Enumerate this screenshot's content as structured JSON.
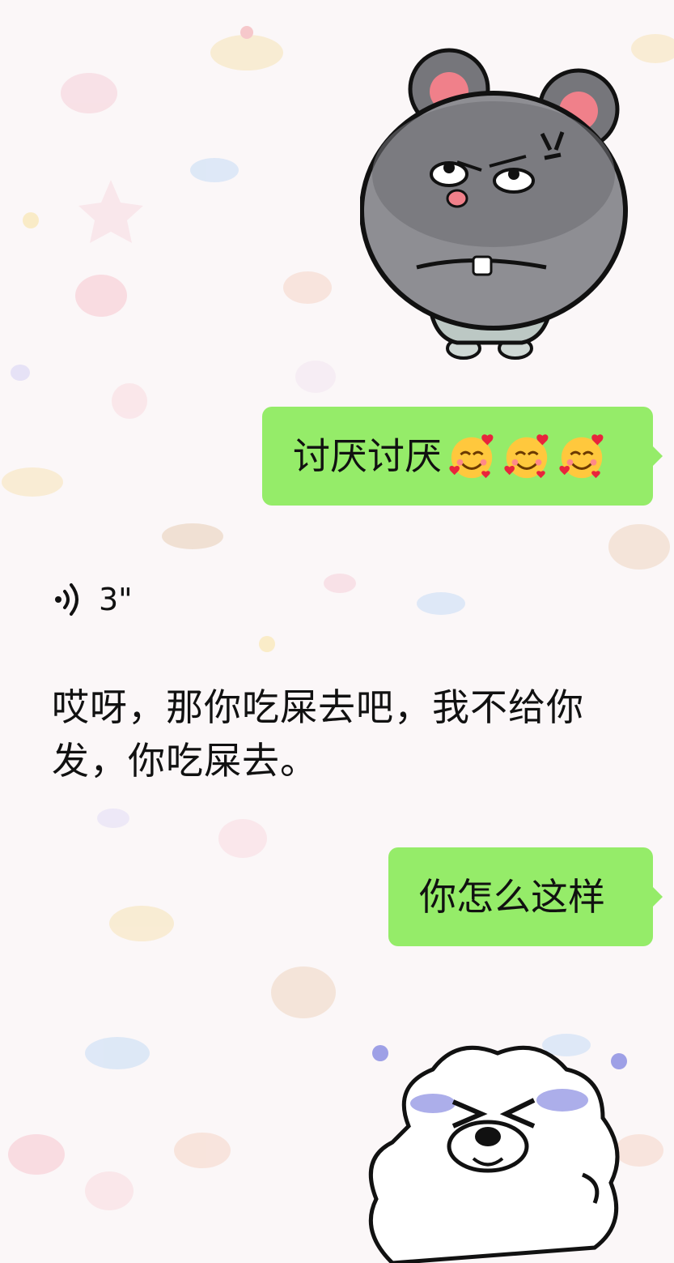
{
  "messages": [
    {
      "type": "sticker",
      "side": "right",
      "sticker_name": "angry-gray-mouse"
    },
    {
      "type": "text",
      "side": "right",
      "text": "讨厌讨厌",
      "emoji": [
        "smiling-face-with-hearts",
        "smiling-face-with-hearts",
        "smiling-face-with-hearts"
      ]
    },
    {
      "type": "voice",
      "side": "left",
      "duration": "3\"",
      "transcript": "哎呀，那你吃屎去吧，我不给你发，你吃屎去。"
    },
    {
      "type": "text",
      "side": "right",
      "text": "你怎么这样"
    },
    {
      "type": "sticker",
      "side": "right",
      "sticker_name": "crying-white-puppy"
    }
  ],
  "colors": {
    "bubble_self": "#95ec69",
    "background": "#fbf7f8",
    "mouse_body": "#8e8e93",
    "mouse_ear": "#f0808a",
    "puppy_tears": "#9ea0e6"
  },
  "icons": [
    "voice-wave-icon",
    "smiling-face-with-hearts-emoji"
  ]
}
